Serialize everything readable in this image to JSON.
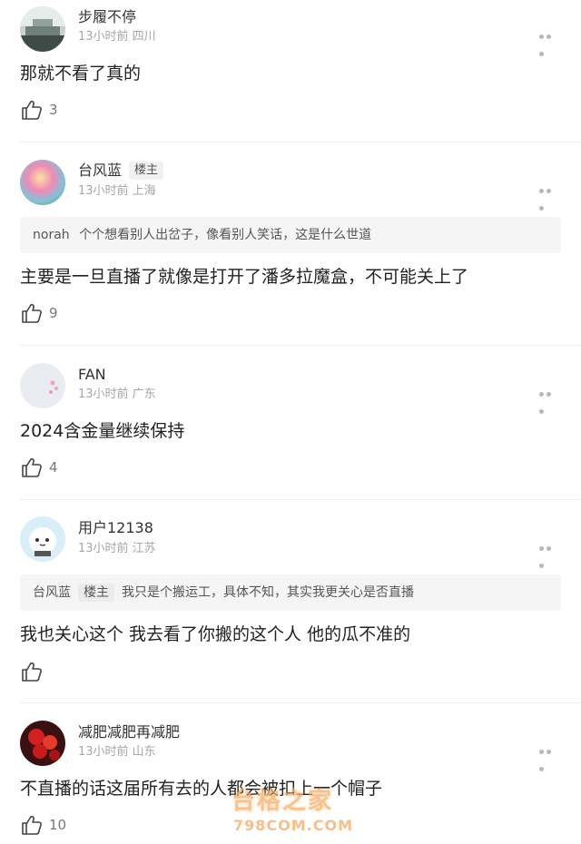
{
  "comments": [
    {
      "name": "步履不停",
      "badge": "",
      "meta": "13小时前 四川",
      "quote": null,
      "text": "那就不看了真的",
      "likes": "3"
    },
    {
      "name": "台风蓝",
      "badge": "楼主",
      "meta": "13小时前 上海",
      "quote": {
        "author": "norah",
        "author_badge": "",
        "text": "个个想看别人出岔子，像看别人笑话，这是什么世道"
      },
      "text": "主要是一旦直播了就像是打开了潘多拉魔盒，不可能关上了",
      "likes": "9"
    },
    {
      "name": "FAN",
      "badge": "",
      "meta": "13小时前 广东",
      "quote": null,
      "text": "2024含金量继续保持",
      "likes": "4"
    },
    {
      "name": "用户12138",
      "badge": "",
      "meta": "13小时前 江苏",
      "quote": {
        "author": "台风蓝",
        "author_badge": "楼主",
        "text": "我只是个搬运工，具体不知，其实我更关心是否直播"
      },
      "text": "我也关心这个 我去看了你搬的这个人 他的瓜不准的",
      "likes": ""
    },
    {
      "name": "减肥减肥再减肥",
      "badge": "",
      "meta": "13小时前 山东",
      "quote": null,
      "text": "不直播的话这届所有去的人都会被扣上一个帽子",
      "likes": "10"
    }
  ],
  "watermark": {
    "line1": "台格之家",
    "line2": "798COM.COM"
  }
}
